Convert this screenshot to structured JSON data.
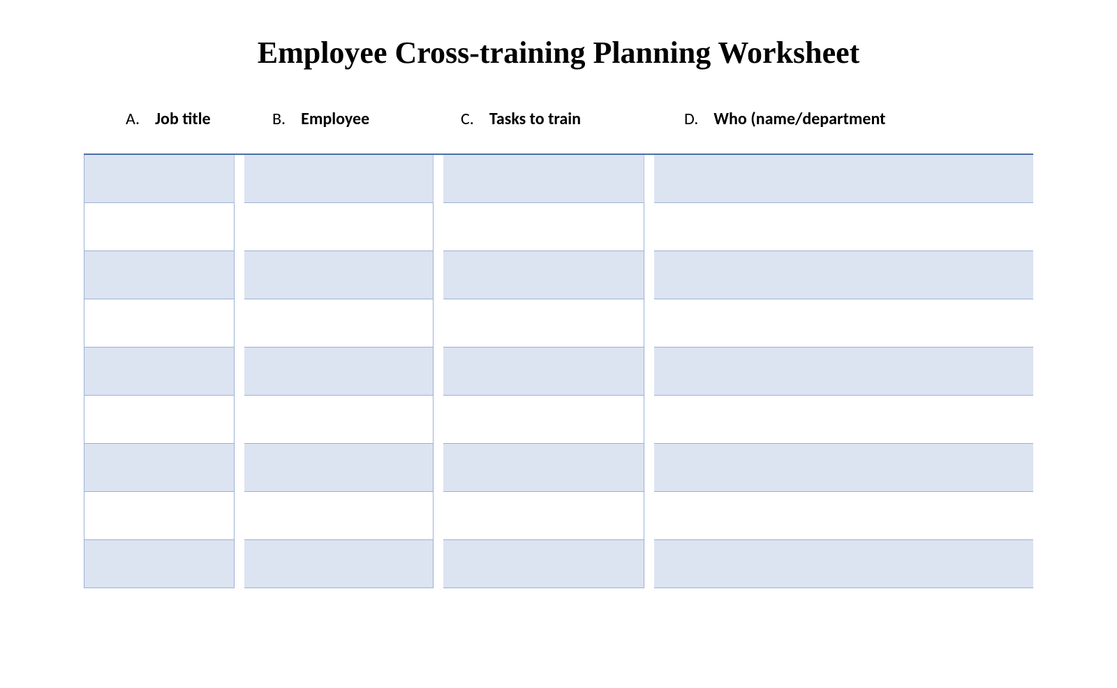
{
  "title": "Employee Cross-training Planning Worksheet",
  "columns": {
    "a": {
      "letter": "A.",
      "label": "Job title"
    },
    "b": {
      "letter": "B.",
      "label": "Employee"
    },
    "c": {
      "letter": "C.",
      "label": "Tasks to train"
    },
    "d": {
      "letter": "D.",
      "label": "Who (name/department"
    }
  },
  "rows": [
    {
      "shaded": true,
      "cells": [
        "",
        "",
        "",
        ""
      ]
    },
    {
      "shaded": false,
      "cells": [
        "",
        "",
        "",
        ""
      ]
    },
    {
      "shaded": true,
      "cells": [
        "",
        "",
        "",
        ""
      ]
    },
    {
      "shaded": false,
      "cells": [
        "",
        "",
        "",
        ""
      ]
    },
    {
      "shaded": true,
      "cells": [
        "",
        "",
        "",
        ""
      ]
    },
    {
      "shaded": false,
      "cells": [
        "",
        "",
        "",
        ""
      ]
    },
    {
      "shaded": true,
      "cells": [
        "",
        "",
        "",
        ""
      ]
    },
    {
      "shaded": false,
      "cells": [
        "",
        "",
        "",
        ""
      ]
    },
    {
      "shaded": true,
      "cells": [
        "",
        "",
        "",
        ""
      ]
    }
  ]
}
